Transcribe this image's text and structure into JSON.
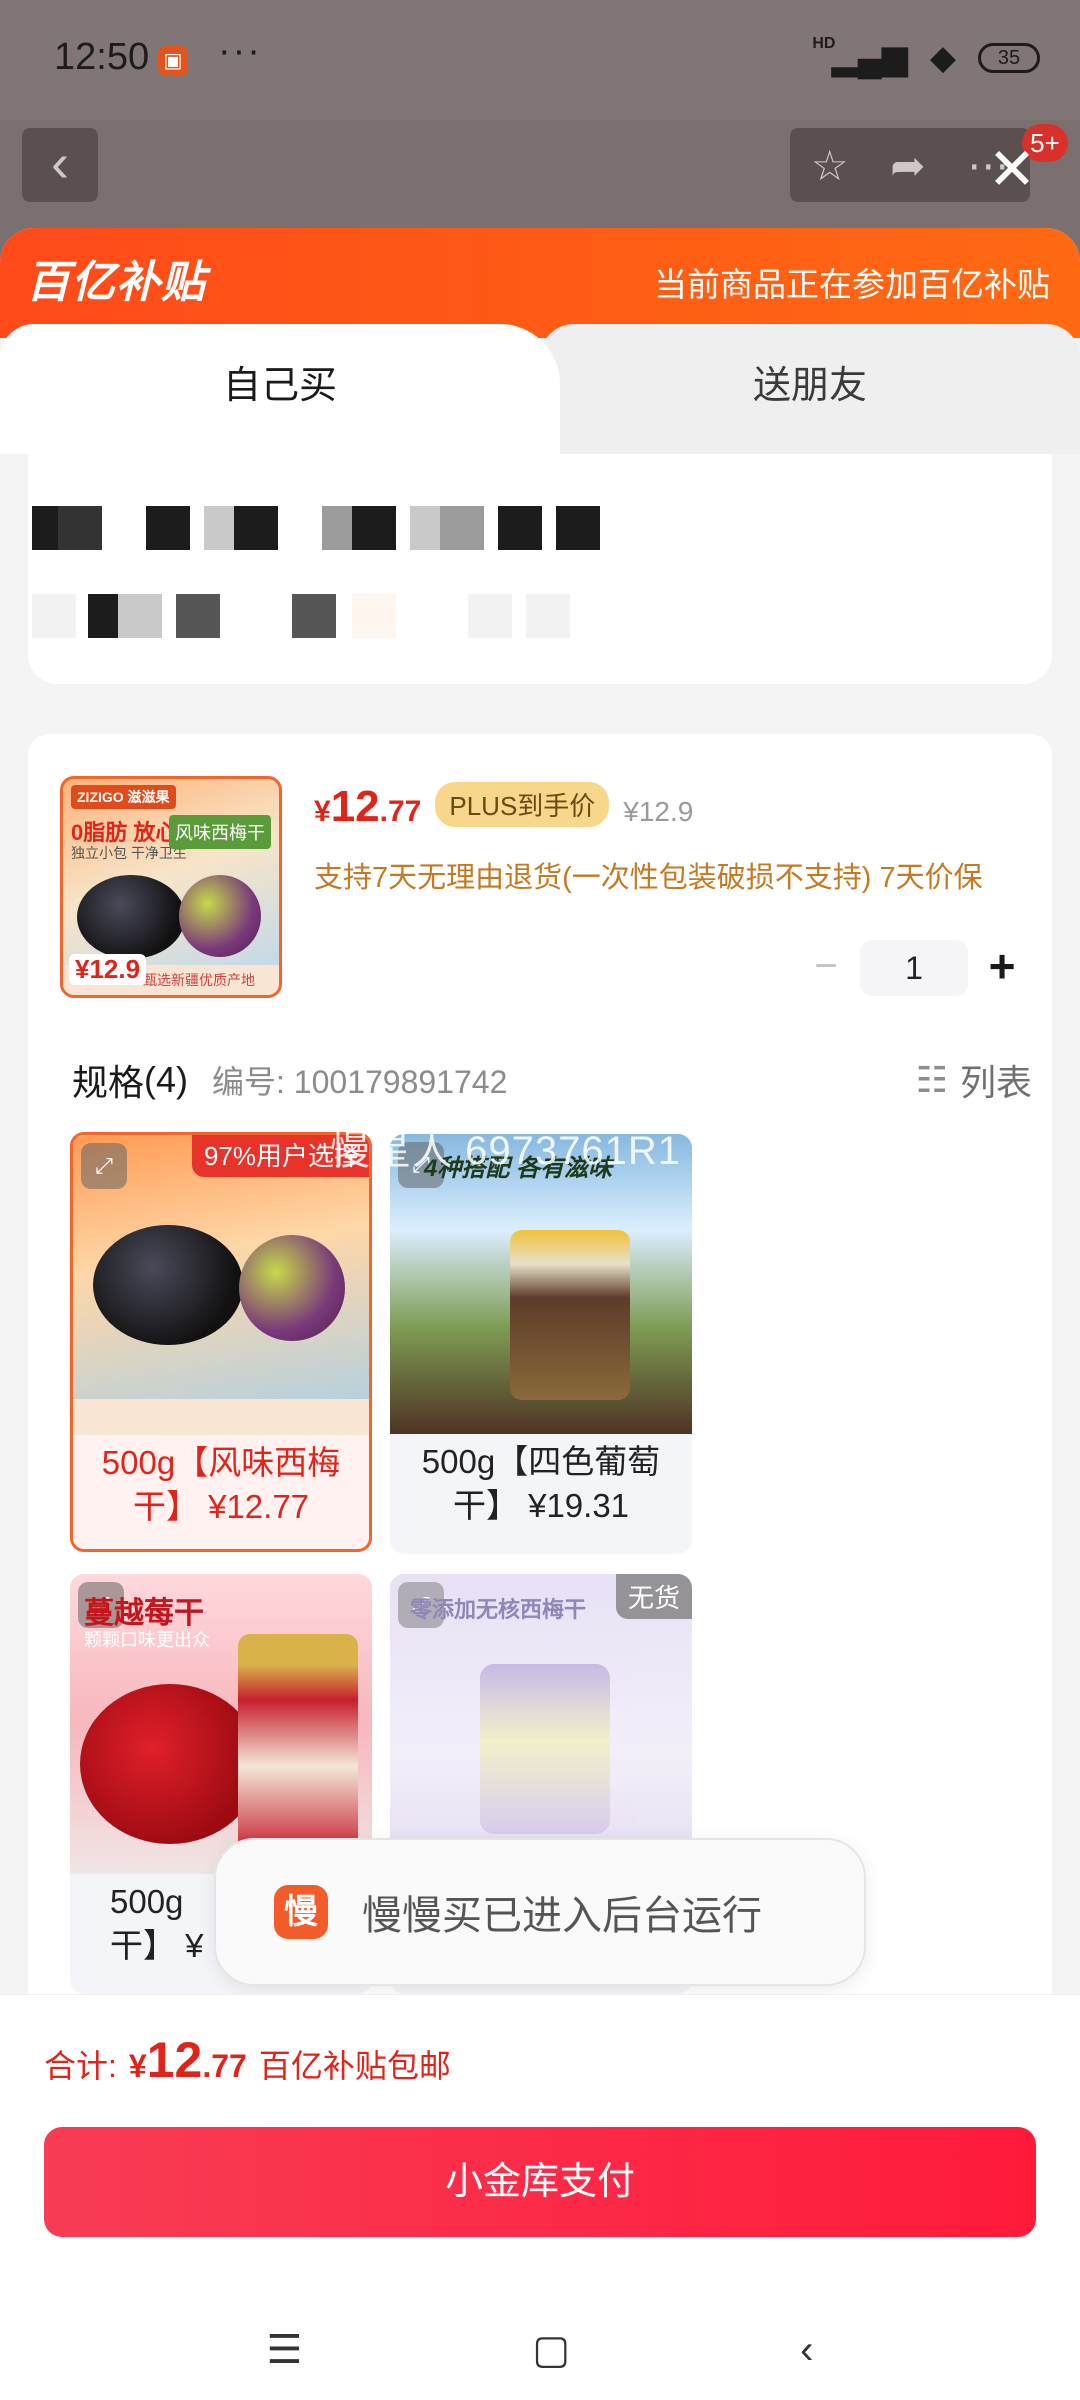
{
  "status_bar": {
    "time": "12:50",
    "dots": "···",
    "network": "HD",
    "battery": "35"
  },
  "background": {
    "badge": "5+"
  },
  "banner": {
    "logo": "百亿补贴",
    "text": "当前商品正在参加百亿补贴"
  },
  "tabs": {
    "self": "自己买",
    "gift": "送朋友"
  },
  "product": {
    "thumb": {
      "brand": "ZIZIGO 滋滋果",
      "title": "0脂肪 放心吃",
      "subtitle": "独立小包 干净卫生",
      "tag": "风味西梅干",
      "price": "¥12.9",
      "bottom": "甄选新疆优质产地"
    },
    "currency": "¥",
    "price_int": "12",
    "price_dec": ".77",
    "plus_tag": "PLUS到手价",
    "orig_price": "¥12.9",
    "return_policy": "支持7天无理由退货(一次性包装破损不支持)   7天价保",
    "quantity": "1"
  },
  "spec": {
    "title": "规格",
    "count": "(4)",
    "code": "编号: 100179891742",
    "list": "列表"
  },
  "variants": [
    {
      "label": "500g【风味西梅干】 ¥12.77",
      "tag": "97%用户选择"
    },
    {
      "label": "500g【四色葡萄干】 ¥19.31",
      "img_caption": "4种搭配 各有滋味"
    },
    {
      "label": "500g",
      "label2": "干】 ¥",
      "img_caption": "蔓越莓干",
      "img_sub": "颗颗口味更出众"
    },
    {
      "label": "",
      "img_caption": "零添加无核西梅干",
      "nostock": "无货"
    }
  ],
  "watermark": "慢星人 6973761R1",
  "toast": {
    "icon": "慢",
    "text": "慢慢买已进入后台运行"
  },
  "footer": {
    "total_label": "合计:",
    "currency": "¥",
    "total_int": "12",
    "total_dec": ".77",
    "total_note": "百亿补贴包邮",
    "pay_button": "小金库支付"
  }
}
